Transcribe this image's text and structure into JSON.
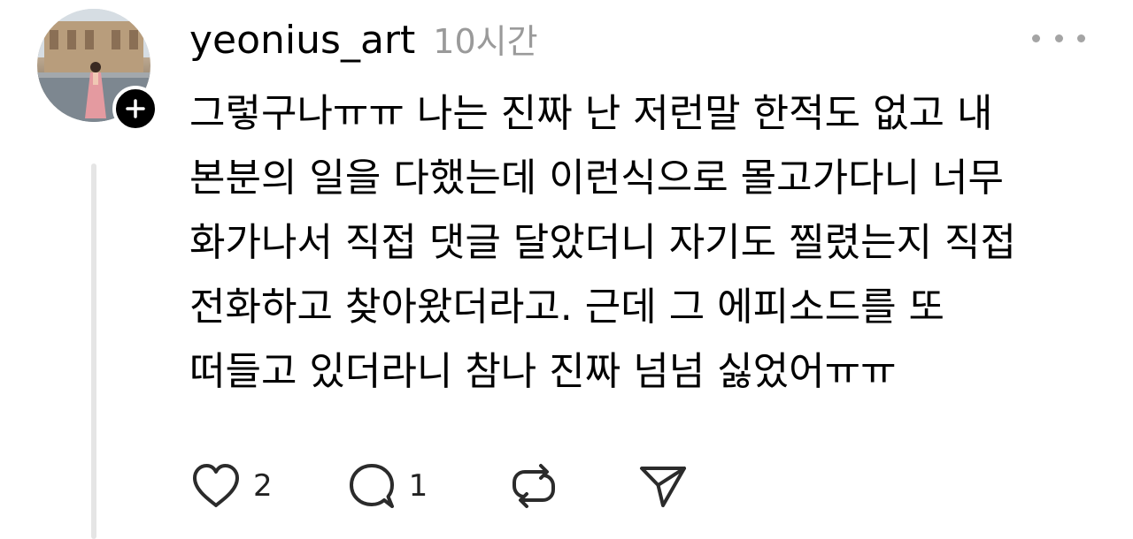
{
  "post": {
    "username": "yeonius_art",
    "timestamp": "10시간",
    "body_lines": [
      "그렇구나ㅠㅠ 나는 진짜 난 저런말 한적도 없고 내",
      "본분의 일을 다했는데 이런식으로 몰고가다니 너무",
      "화가나서 직접 댓글 달았더니 자기도 찔렸는지 직접",
      "전화하고 찾아왔더라고. 근데 그 에피소드를 또",
      "떠들고 있더라니 참나 진짜 넘넘 싫었어ㅠㅠ"
    ]
  },
  "actions": {
    "like": {
      "icon": "heart-icon",
      "count": "2"
    },
    "reply": {
      "icon": "comment-icon",
      "count": "1"
    },
    "repost": {
      "icon": "repost-icon"
    },
    "share": {
      "icon": "send-icon"
    }
  },
  "icons": {
    "follow": "plus-icon",
    "more": "more-dots-icon"
  },
  "colors": {
    "text": "#000000",
    "muted": "#9a9a9a",
    "icon": "#2b2b2b",
    "thread_line": "#e5e5e5",
    "badge": "#000000"
  }
}
